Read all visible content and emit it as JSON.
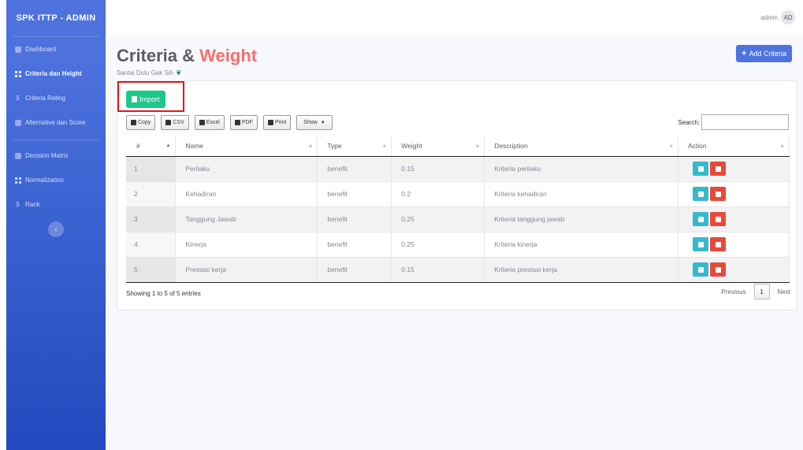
{
  "brand": "SPK ITTP - ADMIN",
  "sidebar": {
    "items": [
      {
        "label": "Dashboard",
        "icon": "dashboard-icon"
      },
      {
        "label": "Criteria dan Height",
        "icon": "table-icon"
      },
      {
        "label": "Criteria Rating",
        "icon": "dollar-icon"
      },
      {
        "label": "Alternative dan Score",
        "icon": "list-icon"
      },
      {
        "label": "Decision Matrix",
        "icon": "grid-icon"
      },
      {
        "label": "Normalization",
        "icon": "table-icon"
      },
      {
        "label": "Rank",
        "icon": "dollar-icon"
      }
    ],
    "toggle": "‹"
  },
  "topbar": {
    "user": "admin",
    "avatar": "AD"
  },
  "page": {
    "title_part1": "Criteria &",
    "title_part2": "Weight",
    "subtitle": "Santai Dulu Gak Sih",
    "add_button": "Add Criteria",
    "import_button": "Import"
  },
  "export_buttons": {
    "copy": "Copy",
    "csv": "CSV",
    "excel": "Excel",
    "pdf": "PDF",
    "print": "Print",
    "show": "Show"
  },
  "search": {
    "label": "Search:",
    "value": ""
  },
  "table": {
    "headers": [
      "#",
      "Name",
      "Type",
      "Weight",
      "Description",
      "Action"
    ],
    "rows": [
      [
        "1",
        "Perilaku",
        "benefit",
        "0.15",
        "Kriteria perilaku"
      ],
      [
        "2",
        "Kehadiran",
        "benefit",
        "0.2",
        "Kriteria kehadiran"
      ],
      [
        "3",
        "Tanggung Jawab",
        "benefit",
        "0.25",
        "Kriteria tanggung jawab"
      ],
      [
        "4",
        "Kinerja",
        "benefit",
        "0.25",
        "Kriteria kinerja"
      ],
      [
        "5",
        "Prestasi kerja",
        "benefit",
        "0.15",
        "Kriteria prestasi kerja"
      ]
    ]
  },
  "footer": {
    "info": "Showing 1 to 5 of 5 entries",
    "previous": "Previous",
    "page": "1",
    "next": "Next"
  },
  "colors": {
    "primary": "#4e73df",
    "success": "#1cc88a",
    "info": "#36b9cc",
    "danger": "#e74a3b",
    "accent": "#f76d6d"
  }
}
